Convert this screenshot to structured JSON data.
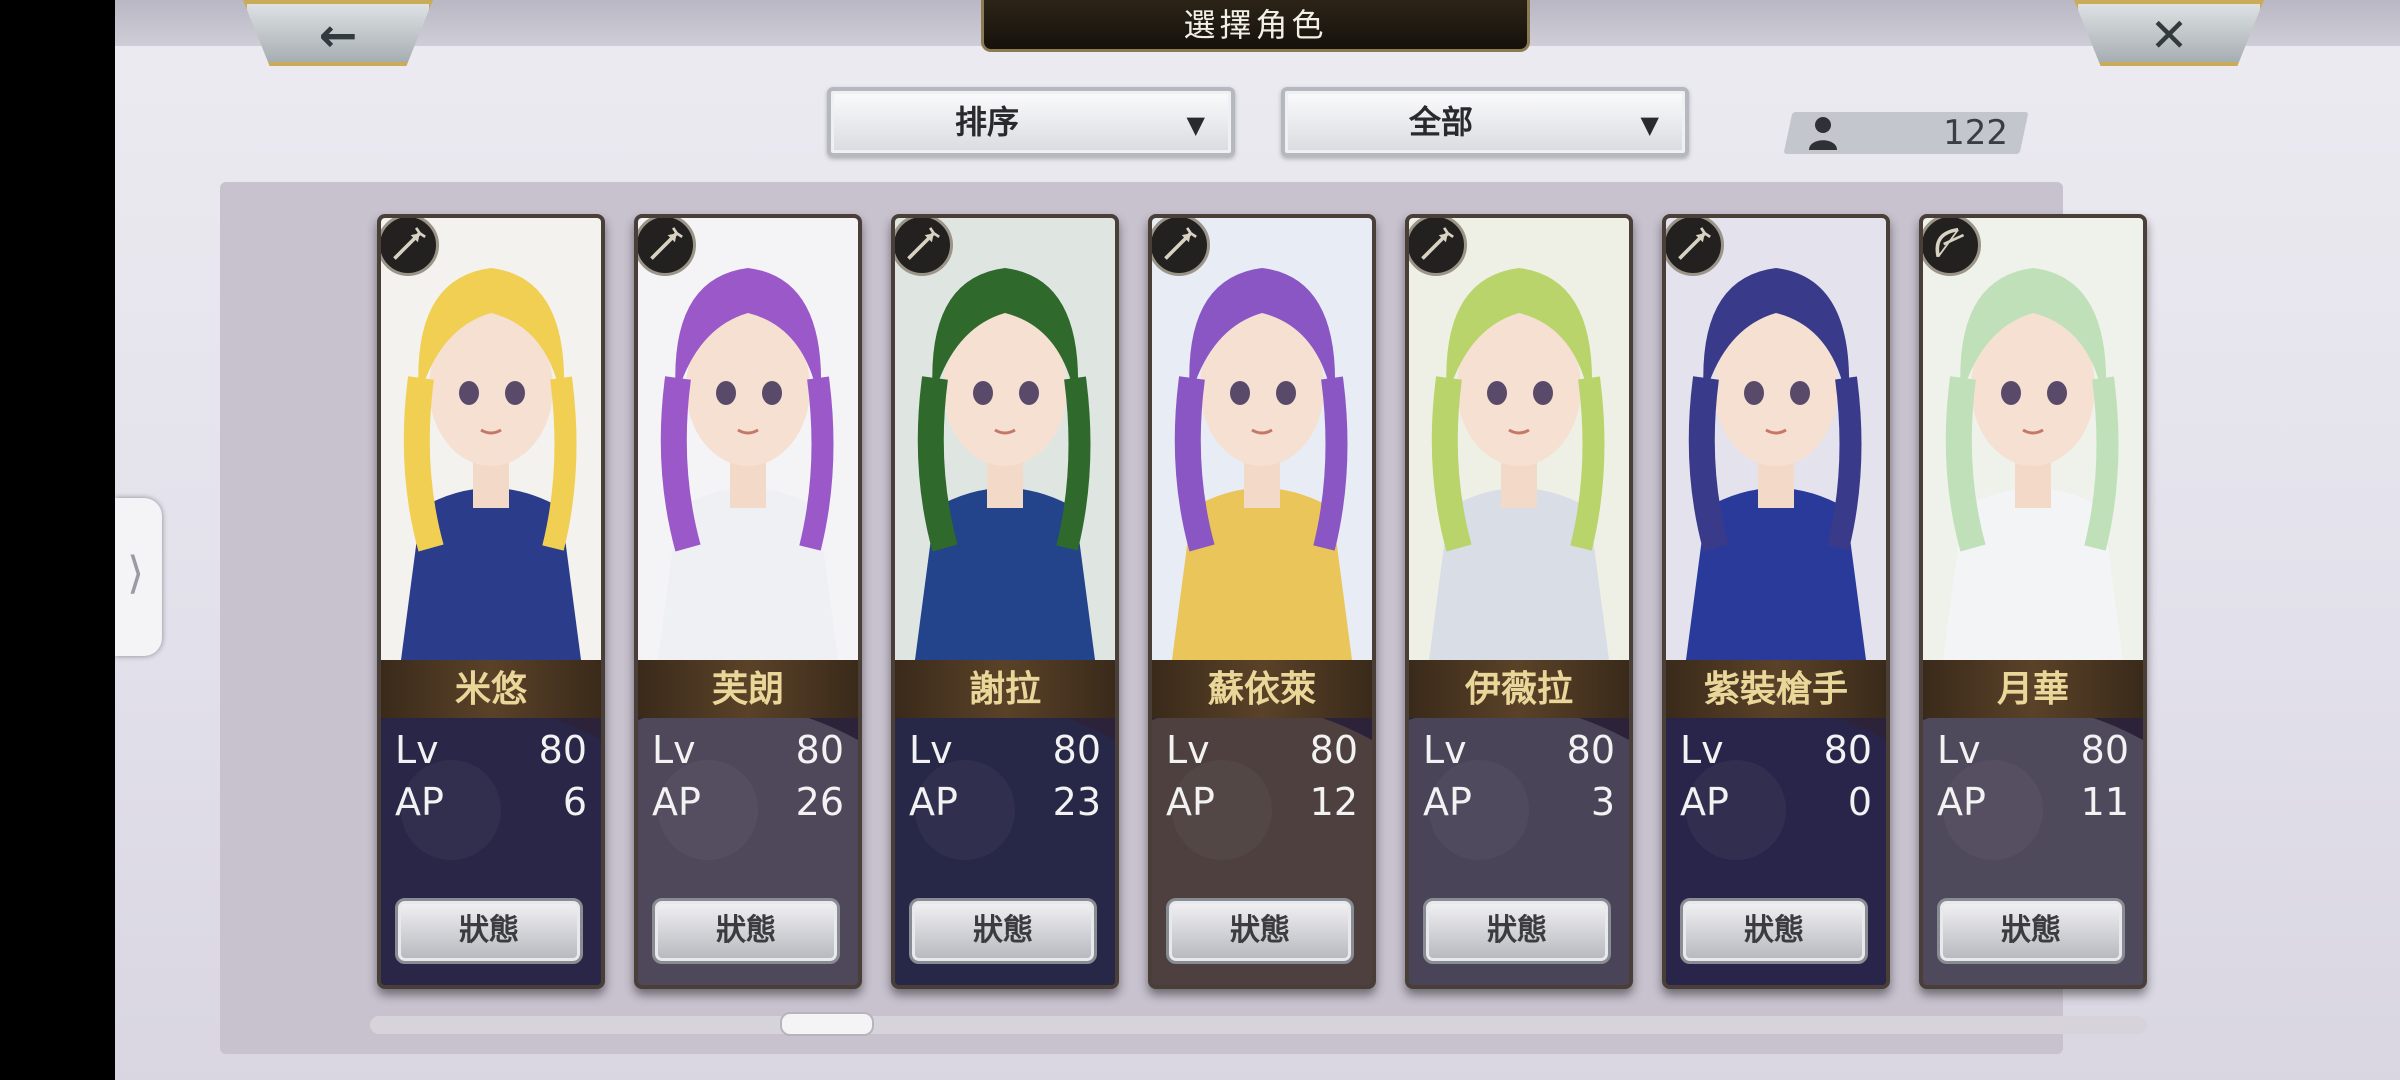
{
  "screen": {
    "title": "選擇角色",
    "back_icon": "back-arrow-icon",
    "close_icon": "close-icon"
  },
  "filters": {
    "sort_label": "排序",
    "category_label": "全部"
  },
  "roster": {
    "count": "122",
    "icon": "person-icon"
  },
  "stat_labels": {
    "level": "Lv",
    "ap": "AP",
    "status_button": "狀態"
  },
  "characters": [
    {
      "name": "米悠",
      "lv": "80",
      "ap": "6",
      "class_icon": "spear-icon",
      "hair": "#f1cf52",
      "outfit": "#2a3c8a",
      "bg": "#f3f2ee"
    },
    {
      "name": "芙朗",
      "lv": "80",
      "ap": "26",
      "class_icon": "spear-icon",
      "hair": "#9a58c8",
      "outfit": "#eef0f4",
      "bg": "#f4f4f6"
    },
    {
      "name": "謝拉",
      "lv": "80",
      "ap": "23",
      "class_icon": "spear-icon",
      "hair": "#2f6a2c",
      "outfit": "#23438a",
      "bg": "#dfe6e2"
    },
    {
      "name": "蘇依萊",
      "lv": "80",
      "ap": "12",
      "class_icon": "spear-icon",
      "hair": "#8a56c4",
      "outfit": "#e9c55a",
      "bg": "#e8ecf4"
    },
    {
      "name": "伊薇拉",
      "lv": "80",
      "ap": "3",
      "class_icon": "spear-icon",
      "hair": "#b9d46a",
      "outfit": "#d8dde6",
      "bg": "#eef0e6"
    },
    {
      "name": "紫裝槍手",
      "lv": "80",
      "ap": "0",
      "class_icon": "spear-icon",
      "hair": "#3a3a8a",
      "outfit": "#2a3a9a",
      "bg": "#e4e2ec"
    },
    {
      "name": "月華",
      "lv": "80",
      "ap": "11",
      "class_icon": "bow-icon",
      "hair": "#bfe0b8",
      "outfit": "#f2f4f6",
      "bg": "#eef2ea"
    }
  ]
}
